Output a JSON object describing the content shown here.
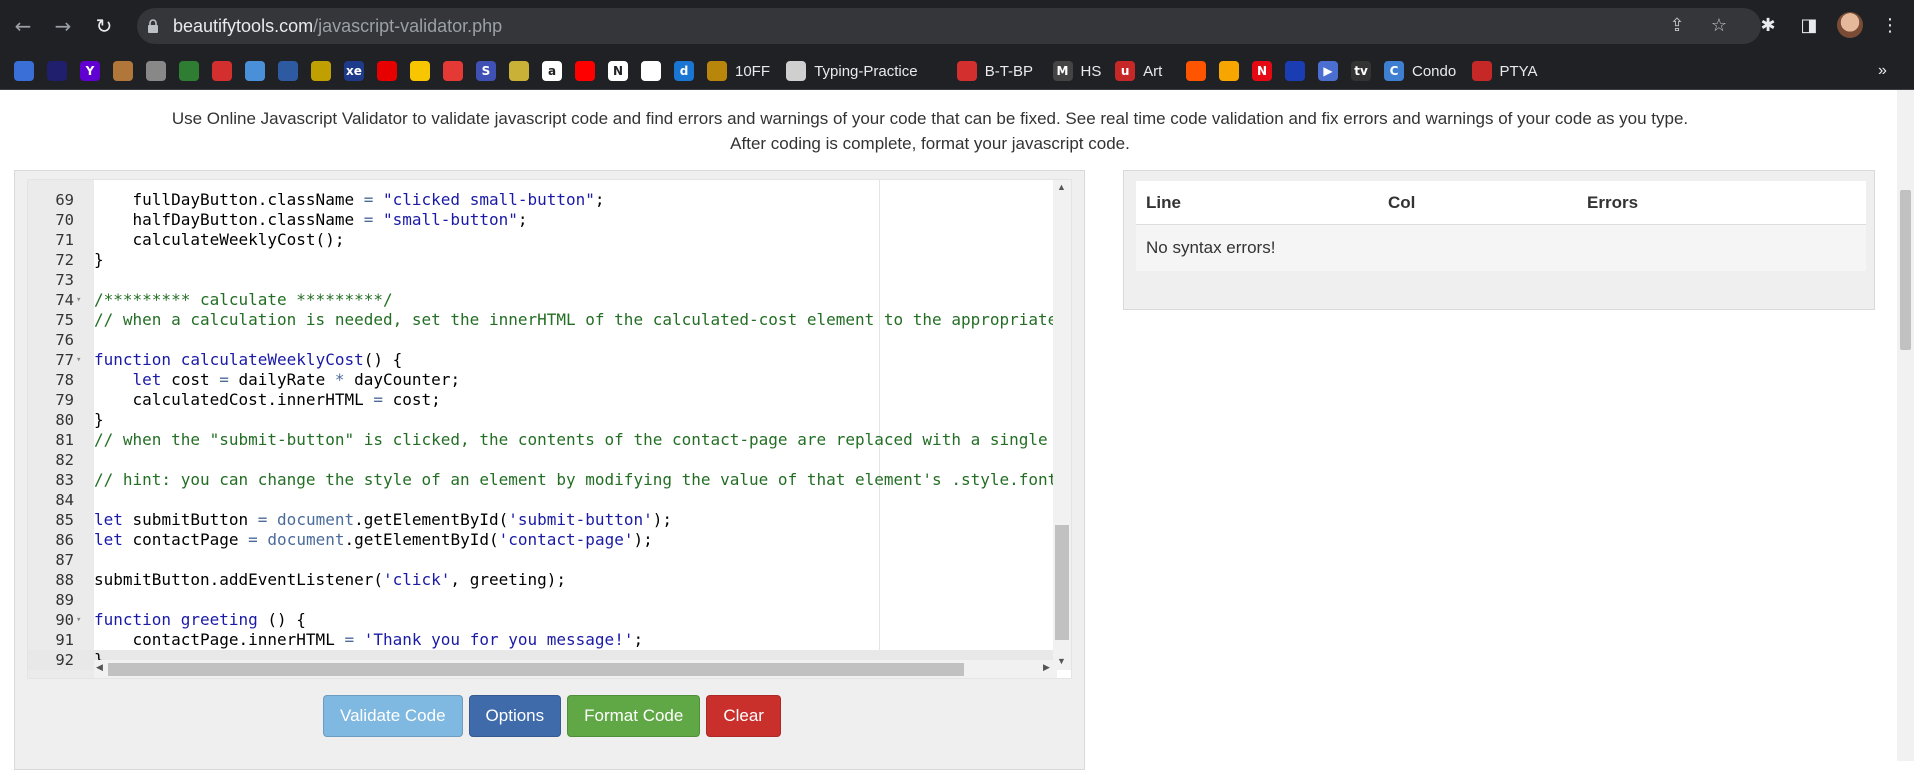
{
  "browser": {
    "url_host": "beautifytools.com",
    "url_path": "/javascript-validator.php",
    "icons": [
      "back-arrow-icon",
      "forward-arrow-icon",
      "reload-icon",
      "lock-icon",
      "share-icon",
      "star-icon",
      "extensions-icon",
      "side-panel-icon",
      "menu-icon"
    ]
  },
  "bookmarks": [
    {
      "label": "",
      "icon": "app-icon",
      "color": "#3b6fd8"
    },
    {
      "label": "",
      "icon": "uc-icon",
      "color": "#1f1f6e"
    },
    {
      "label": "",
      "icon": "yahoo-icon",
      "color": "#6001d2"
    },
    {
      "label": "",
      "icon": "chrome-icon",
      "color": "#b1773a"
    },
    {
      "label": "",
      "icon": "apple-icon",
      "color": "#888888"
    },
    {
      "label": "",
      "icon": "hex-icon",
      "color": "#2e7d32"
    },
    {
      "label": "",
      "icon": "swirl-icon",
      "color": "#d32f2f"
    },
    {
      "label": "",
      "icon": "cloud-icon",
      "color": "#4a90d9"
    },
    {
      "label": "",
      "icon": "crest-icon",
      "color": "#2d5aa0"
    },
    {
      "label": "",
      "icon": "badge-icon",
      "color": "#c0a000"
    },
    {
      "label": "",
      "icon": "xe-icon",
      "color": "#1e3a8a"
    },
    {
      "label": "",
      "icon": "vodafone-icon",
      "color": "#e60000"
    },
    {
      "label": "",
      "icon": "home-icon",
      "color": "#f7c600"
    },
    {
      "label": "",
      "icon": "pin-icon",
      "color": "#e53935"
    },
    {
      "label": "",
      "icon": "s-icon",
      "color": "#3f51b5"
    },
    {
      "label": "",
      "icon": "image-icon",
      "color": "#c9b037"
    },
    {
      "label": "",
      "icon": "amazon-icon",
      "color": "#ffffff"
    },
    {
      "label": "",
      "icon": "youtube-icon",
      "color": "#ff0000"
    },
    {
      "label": "",
      "icon": "notion-icon",
      "color": "#ffffff"
    },
    {
      "label": "",
      "icon": "pinwheel-icon",
      "color": "#ffffff"
    },
    {
      "label": "",
      "icon": "d-icon",
      "color": "#1976d2"
    },
    {
      "label": "10FF",
      "icon": "crest-icon",
      "color": "#b8860b"
    },
    {
      "label": "Typing-Practice",
      "icon": "doc-icon",
      "color": "#cfcfcf"
    },
    {
      "label": "B-T-BP",
      "icon": "stripe-icon",
      "color": "#d32f2f"
    },
    {
      "label": "HS",
      "icon": "m-icon",
      "color": "#444444"
    },
    {
      "label": "Art",
      "icon": "u-icon",
      "color": "#c62828"
    },
    {
      "label": "",
      "icon": "soundcloud-icon",
      "color": "#ff5500"
    },
    {
      "label": "",
      "icon": "audible-icon",
      "color": "#f7a600"
    },
    {
      "label": "",
      "icon": "netflix-icon",
      "color": "#e50914"
    },
    {
      "label": "",
      "icon": "disney-icon",
      "color": "#1a3db3"
    },
    {
      "label": "",
      "icon": "play-icon",
      "color": "#4a6fd1"
    },
    {
      "label": "",
      "icon": "appletv-icon",
      "color": "#333333"
    },
    {
      "label": "Condo",
      "icon": "c-icon",
      "color": "#3f7fd1"
    },
    {
      "label": "PTYA",
      "icon": "film-icon",
      "color": "#c62828"
    }
  ],
  "intro_text": "Use Online Javascript Validator to validate javascript code and find errors and warnings of your code that can be fixed. See real time code validation and fix errors and warnings of your code as you type. After coding is complete, format your javascript code.",
  "editor": {
    "lines": [
      {
        "n": "69",
        "fold": "",
        "text": "    fullDayButton.className = \"clicked small-button\";"
      },
      {
        "n": "70",
        "fold": "",
        "text": "    halfDayButton.className = \"small-button\";"
      },
      {
        "n": "71",
        "fold": "",
        "text": "    calculateWeeklyCost();"
      },
      {
        "n": "72",
        "fold": "",
        "text": "}"
      },
      {
        "n": "73",
        "fold": "",
        "text": ""
      },
      {
        "n": "74",
        "fold": "▾",
        "text": "/********* calculate *********/"
      },
      {
        "n": "75",
        "fold": "",
        "text": "// when a calculation is needed, set the innerHTML of the calculated-cost element to the appropriate"
      },
      {
        "n": "76",
        "fold": "",
        "text": ""
      },
      {
        "n": "77",
        "fold": "▾",
        "text": "function calculateWeeklyCost() {"
      },
      {
        "n": "78",
        "fold": "",
        "text": "    let cost = dailyRate * dayCounter;"
      },
      {
        "n": "79",
        "fold": "",
        "text": "    calculatedCost.innerHTML = cost;"
      },
      {
        "n": "80",
        "fold": "",
        "text": "}"
      },
      {
        "n": "81",
        "fold": "",
        "text": "// when the \"submit-button\" is clicked, the contents of the contact-page are replaced with a single"
      },
      {
        "n": "82",
        "fold": "",
        "text": ""
      },
      {
        "n": "83",
        "fold": "",
        "text": "// hint: you can change the style of an element by modifying the value of that element's .style.font"
      },
      {
        "n": "84",
        "fold": "",
        "text": ""
      },
      {
        "n": "85",
        "fold": "",
        "text": "let submitButton = document.getElementById('submit-button');"
      },
      {
        "n": "86",
        "fold": "",
        "text": "let contactPage = document.getElementById('contact-page');"
      },
      {
        "n": "87",
        "fold": "",
        "text": ""
      },
      {
        "n": "88",
        "fold": "",
        "text": "submitButton.addEventListener('click', greeting);"
      },
      {
        "n": "89",
        "fold": "",
        "text": ""
      },
      {
        "n": "90",
        "fold": "▾",
        "text": "function greeting () {"
      },
      {
        "n": "91",
        "fold": "",
        "text": "    contactPage.innerHTML = 'Thank you for you message!';"
      },
      {
        "n": "92",
        "fold": "",
        "text": "}"
      }
    ]
  },
  "buttons": [
    {
      "label": "Validate Code",
      "color": "#7fb8e0",
      "name": "validate-code-button"
    },
    {
      "label": "Options",
      "color": "#3f6bab",
      "name": "options-button"
    },
    {
      "label": "Format Code",
      "color": "#5fa845",
      "name": "format-code-button"
    },
    {
      "label": "Clear",
      "color": "#c9302c",
      "name": "clear-button"
    }
  ],
  "results": {
    "headers": [
      "Line",
      "Col",
      "Errors"
    ],
    "message": "No syntax errors!"
  }
}
